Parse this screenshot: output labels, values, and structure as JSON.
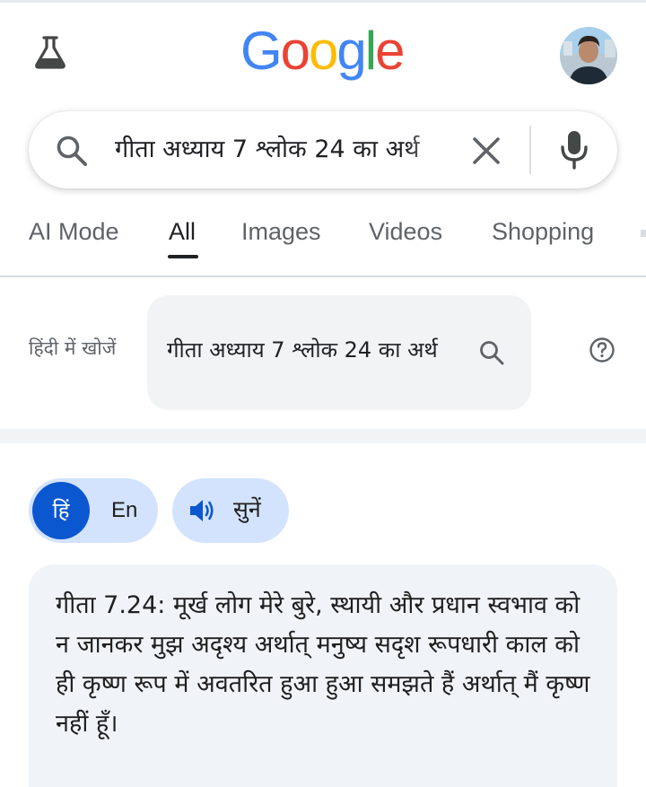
{
  "header": {
    "logo_letters": [
      {
        "char": "G",
        "color": "#4285F4"
      },
      {
        "char": "o",
        "color": "#EA4335"
      },
      {
        "char": "o",
        "color": "#FBBC05"
      },
      {
        "char": "g",
        "color": "#4285F4"
      },
      {
        "char": "l",
        "color": "#34A853"
      },
      {
        "char": "e",
        "color": "#EA4335"
      }
    ],
    "labs_icon": "flask-icon",
    "avatar_icon": "profile-avatar"
  },
  "search": {
    "query": "गीता अध्याय 7 श्लोक 24 का अर्थ",
    "search_icon": "search-icon",
    "clear_icon": "close-icon",
    "mic_icon": "mic-icon"
  },
  "tabs": [
    {
      "label": "AI Mode",
      "active": false
    },
    {
      "label": "All",
      "active": true
    },
    {
      "label": "Images",
      "active": false
    },
    {
      "label": "Videos",
      "active": false
    },
    {
      "label": "Shopping",
      "active": false
    }
  ],
  "hindi_search": {
    "label": "हिंदी में खोजें",
    "suggestion": "गीता अध्याय 7 श्लोक 24 का अर्थ",
    "help_icon": "help-icon"
  },
  "language_toggle": {
    "hindi": "हिं",
    "english": "En"
  },
  "listen": {
    "label": "सुनें",
    "icon": "speaker-icon"
  },
  "answer": {
    "text": "गीता 7.24: मूर्ख लोग मेरे बुरे, स्थायी और प्रधान स्वभाव को न जानकर मुझ अदृश्य अर्थात् मनुष्य सदृश रूपधारी काल को ही कृष्ण रूप में अवतरित हुआ हुआ समझते हैं अर्थात् मैं कृष्ण नहीं हूँ।"
  },
  "colors": {
    "accent_blue": "#0b57d0",
    "chip_blue": "#d3e3fd",
    "card_bg": "#f0f4f9"
  }
}
